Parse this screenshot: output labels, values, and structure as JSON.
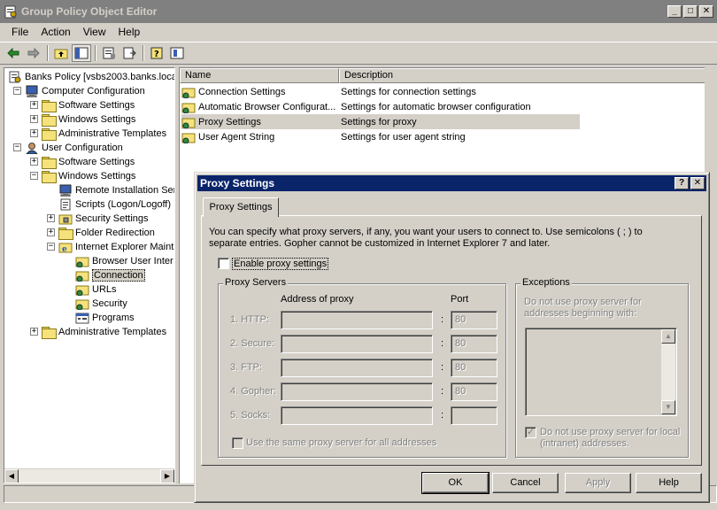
{
  "window": {
    "title": "Group Policy Object Editor",
    "min": "_",
    "max": "□",
    "close": "✕"
  },
  "menu": [
    "File",
    "Action",
    "View",
    "Help"
  ],
  "tree": [
    {
      "label": "Banks Policy [vsbs2003.banks.loca",
      "indent": 0,
      "icon": "policy-icon",
      "exp": ""
    },
    {
      "label": "Computer Configuration",
      "indent": 1,
      "icon": "computer-icon",
      "exp": "−"
    },
    {
      "label": "Software Settings",
      "indent": 2,
      "icon": "folder-icon",
      "exp": "+"
    },
    {
      "label": "Windows Settings",
      "indent": 2,
      "icon": "folder-icon",
      "exp": "+"
    },
    {
      "label": "Administrative Templates",
      "indent": 2,
      "icon": "folder-icon",
      "exp": "+"
    },
    {
      "label": "User Configuration",
      "indent": 1,
      "icon": "user-icon",
      "exp": "−"
    },
    {
      "label": "Software Settings",
      "indent": 2,
      "icon": "folder-icon",
      "exp": "+"
    },
    {
      "label": "Windows Settings",
      "indent": 2,
      "icon": "folder-icon",
      "exp": "−"
    },
    {
      "label": "Remote Installation Ser",
      "indent": 3,
      "icon": "computer-icon",
      "exp": ""
    },
    {
      "label": "Scripts (Logon/Logoff)",
      "indent": 3,
      "icon": "script-icon",
      "exp": ""
    },
    {
      "label": "Security Settings",
      "indent": 3,
      "icon": "security-icon",
      "exp": "+"
    },
    {
      "label": "Folder Redirection",
      "indent": 3,
      "icon": "folder-icon",
      "exp": "+"
    },
    {
      "label": "Internet Explorer Maint",
      "indent": 3,
      "icon": "ie-icon",
      "exp": "−"
    },
    {
      "label": "Browser User Inter",
      "indent": 4,
      "icon": "settings-folder-icon",
      "exp": ""
    },
    {
      "label": "Connection",
      "indent": 4,
      "icon": "settings-folder-icon",
      "exp": "",
      "selected": true
    },
    {
      "label": "URLs",
      "indent": 4,
      "icon": "settings-folder-icon",
      "exp": ""
    },
    {
      "label": "Security",
      "indent": 4,
      "icon": "settings-folder-icon",
      "exp": ""
    },
    {
      "label": "Programs",
      "indent": 4,
      "icon": "programs-icon",
      "exp": ""
    },
    {
      "label": "Administrative Templates",
      "indent": 2,
      "icon": "folder-icon",
      "exp": "+"
    }
  ],
  "list": {
    "columns": [
      "Name",
      "Description"
    ],
    "rows": [
      {
        "name": "Connection Settings",
        "description": "Settings for connection settings"
      },
      {
        "name": "Automatic Browser Configurat...",
        "description": "Settings for automatic browser configuration"
      },
      {
        "name": "Proxy Settings",
        "description": "Settings for proxy",
        "selected": true
      },
      {
        "name": "User Agent String",
        "description": "Settings for user agent string"
      }
    ]
  },
  "dialog": {
    "title": "Proxy Settings",
    "help": "?",
    "close": "✕",
    "tab": "Proxy Settings",
    "intro": "You can specify what proxy servers, if any, you want your users to connect to. Use semicolons ( ; ) to separate entries. Gopher cannot be customized in Internet Explorer 7 and later.",
    "enable_label": "Enable proxy settings",
    "proxy_group": "Proxy Servers",
    "address_header": "Address of proxy",
    "port_header": "Port",
    "servers": [
      {
        "label": "1. HTTP:",
        "address": "",
        "port": "80"
      },
      {
        "label": "2. Secure:",
        "address": "",
        "port": "80"
      },
      {
        "label": "3. FTP:",
        "address": "",
        "port": "80"
      },
      {
        "label": "4. Gopher:",
        "address": "",
        "port": "80"
      },
      {
        "label": "5. Socks:",
        "address": "",
        "port": ""
      }
    ],
    "colon": ":",
    "same_proxy": "Use the same proxy server for all addresses",
    "exceptions_group": "Exceptions",
    "exceptions_desc": "Do not use proxy server for addresses beginning with:",
    "local_label": "Do not use proxy server for local (intranet) addresses.",
    "buttons": {
      "ok": "OK",
      "cancel": "Cancel",
      "apply": "Apply",
      "help": "Help"
    }
  },
  "colors": {
    "dialog_title": "#0a246a",
    "inactive_title": "#808080",
    "face": "#d4d0c8"
  }
}
